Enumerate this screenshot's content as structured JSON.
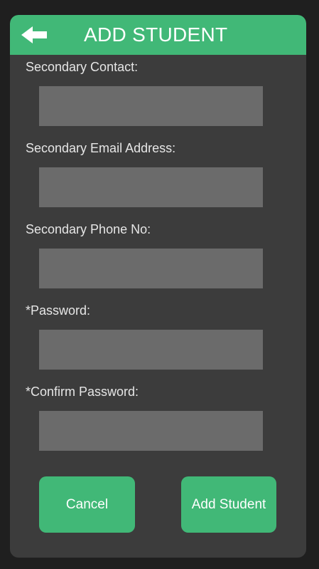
{
  "header": {
    "title": "ADD STUDENT",
    "back_icon": "back-arrow-icon",
    "accent_color": "#41b877"
  },
  "form": {
    "fields": [
      {
        "label": "Secondary Contact:",
        "value": "",
        "type": "text"
      },
      {
        "label": "Secondary Email Address:",
        "value": "",
        "type": "email"
      },
      {
        "label": "Secondary Phone No:",
        "value": "",
        "type": "tel"
      },
      {
        "label": "*Password:",
        "value": "",
        "type": "password"
      },
      {
        "label": "*Confirm Password:",
        "value": "",
        "type": "password"
      }
    ]
  },
  "actions": {
    "cancel_label": "Cancel",
    "add_label": "Add Student"
  }
}
